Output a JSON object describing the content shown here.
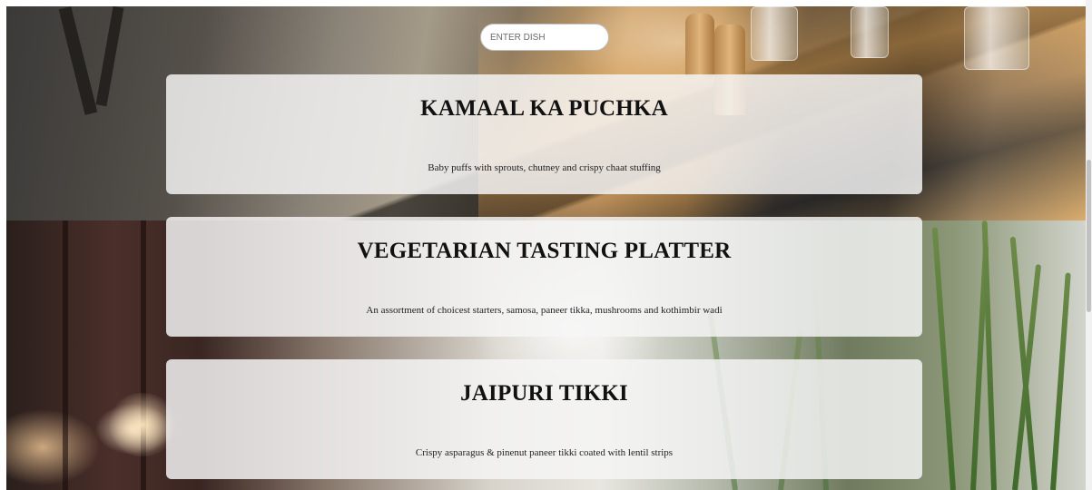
{
  "search": {
    "placeholder": "ENTER DISH"
  },
  "dishes": [
    {
      "name": "KAMAAL KA PUCHKA",
      "description": "Baby puffs with sprouts, chutney and crispy chaat stuffing"
    },
    {
      "name": "VEGETARIAN TASTING PLATTER",
      "description": "An assortment of choicest starters, samosa, paneer tikka, mushrooms and kothimbir wadi"
    },
    {
      "name": "JAIPURI TIKKI",
      "description": "Crispy asparagus & pinenut paneer tikki coated with lentil strips"
    }
  ],
  "colors": {
    "card_background": "#f5f5f5",
    "title_text": "#111111",
    "description_text": "#222222"
  }
}
